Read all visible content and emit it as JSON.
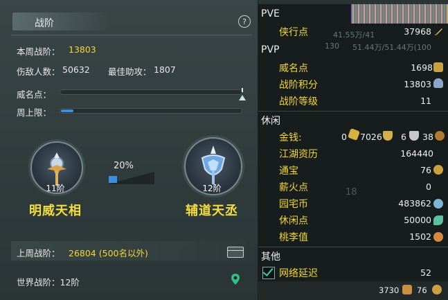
{
  "left": {
    "title": "战阶",
    "help": "?",
    "weekly_rank_label": "本周战阶：",
    "weekly_rank_value": "13803",
    "kills_label": "伤敌人数：",
    "kills_value": "50632",
    "assist_label": "最佳助攻：",
    "assist_value": "1807",
    "prestige_label": "威名点：",
    "prestige_progress": 0.99,
    "weekly_cap_label": "周上限：",
    "weekly_cap_progress": 0.07,
    "current_rank": {
      "level": "11阶",
      "name": "明威天相"
    },
    "next_rank": {
      "level": "12阶",
      "name": "辅道天丞"
    },
    "upgrade_percent": "20%",
    "upgrade_progress": 0.2,
    "last_week_label": "上周战阶：",
    "last_week_value": "26804 (500名以外)",
    "world_rank": "世界战阶：12阶"
  },
  "right": {
    "pve": {
      "header": "PVE",
      "items": [
        {
          "label": "侠行点",
          "value": "37968"
        }
      ],
      "overlay_a": "41.55万/41",
      "overlay_b": "130",
      "overlay_c": "51.44万/51.44万(100"
    },
    "pvp": {
      "header": "PVP",
      "items": [
        {
          "label": "威名点",
          "value": "1698"
        },
        {
          "label": "战阶积分",
          "value": "13803"
        },
        {
          "label": "战阶等级",
          "value": "11"
        }
      ]
    },
    "leisure": {
      "header": "休闲",
      "money_label": "金钱:",
      "money_a": "0",
      "money_b": "7026",
      "money_c": "6",
      "money_d": "38",
      "items": [
        {
          "label": "江湖资历",
          "value": "164440"
        },
        {
          "label": "通宝",
          "value": "76"
        },
        {
          "label": "薪火点",
          "value": "0"
        },
        {
          "label": "园宅币",
          "value": "483862"
        },
        {
          "label": "休闲点",
          "value": "50000"
        },
        {
          "label": "桃李值",
          "value": "1502"
        }
      ],
      "bg_number": "18"
    },
    "other": {
      "header": "其他",
      "latency_label": "网络延迟",
      "latency_value": "52",
      "latency_checked": true
    },
    "bottom": {
      "value_a": "3730",
      "value_b": "76"
    }
  },
  "colors": {
    "accent_yellow": "#f2d73a",
    "progress_blue": "#3a8fe0"
  }
}
